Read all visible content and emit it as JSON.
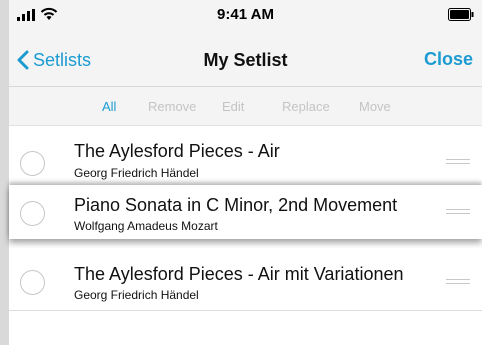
{
  "status_bar": {
    "time": "9:41 AM"
  },
  "nav": {
    "back_label": "Setlists",
    "title": "My Setlist",
    "close_label": "Close"
  },
  "segments": {
    "all": "All",
    "remove": "Remove",
    "edit": "Edit",
    "replace": "Replace",
    "move": "Move",
    "active": "All"
  },
  "items": [
    {
      "title": "The Aylesford Pieces - Air",
      "composer": "Georg Friedrich Händel",
      "selected": false
    },
    {
      "title": "Piano Sonata in C Minor, 2nd Movement",
      "composer": "Wolfgang Amadeus Mozart",
      "selected": false
    },
    {
      "title": "The Aylesford Pieces - Air mit Variationen",
      "composer": "Georg Friedrich Händel",
      "selected": false
    }
  ],
  "colors": {
    "accent": "#1b9bd1",
    "disabled": "#c4c4c4",
    "background": "#f4f4f4"
  },
  "icons": {
    "signal": "signal-bars-icon",
    "wifi": "wifi-icon",
    "battery": "battery-icon",
    "back": "chevron-left-icon",
    "drag": "drag-handle-icon",
    "select": "radio-circle-icon"
  }
}
